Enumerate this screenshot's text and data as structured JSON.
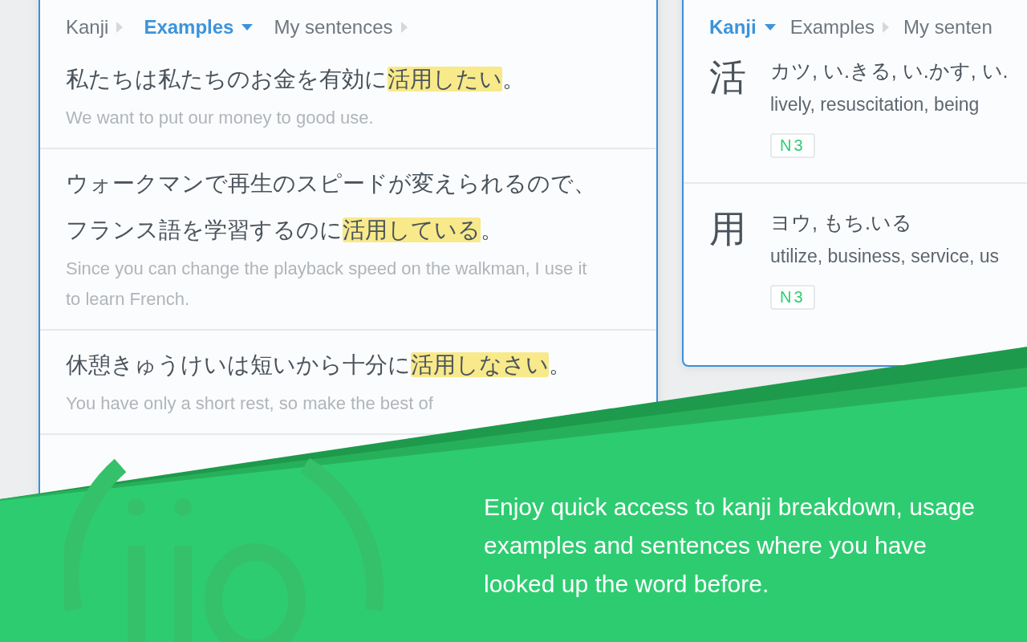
{
  "examples_panel": {
    "breadcrumbs": [
      {
        "label": "Kanji",
        "selected": false
      },
      {
        "label": "Examples",
        "selected": true
      },
      {
        "label": "My sentences",
        "selected": false
      }
    ],
    "sentences": [
      {
        "before": "私たちは私たちのお金を有効に",
        "highlight": "活用したい",
        "after": "。",
        "translation": "We want to put our money to good use."
      },
      {
        "before": "ウォークマンで再生のスピードが変えられるので、フランス語を学習するのに",
        "highlight": "活用している",
        "after": "。",
        "translation": "Since you can change the playback speed on the walkman, I use it to learn French."
      },
      {
        "before": "休憩きゅうけいは短いから十分に",
        "highlight": "活用しなさい",
        "after": "。",
        "translation": "You have only a short rest, so make the best of"
      }
    ]
  },
  "kanji_panel": {
    "breadcrumbs": [
      {
        "label": "Kanji",
        "selected": true
      },
      {
        "label": "Examples",
        "selected": false
      },
      {
        "label": "My senten",
        "selected": false
      }
    ],
    "kanji": [
      {
        "character": "活",
        "readings": "カツ, い.きる, い.かす, い.",
        "meanings": "lively, resuscitation, being",
        "level": "N3"
      },
      {
        "character": "用",
        "readings": "ヨウ, もち.いる",
        "meanings": "utilize, business, service, us",
        "level": "N3"
      }
    ]
  },
  "banner": {
    "text": "Enjoy quick access to kanji breakdown, usage examples and sentences where you have looked up the word before."
  }
}
